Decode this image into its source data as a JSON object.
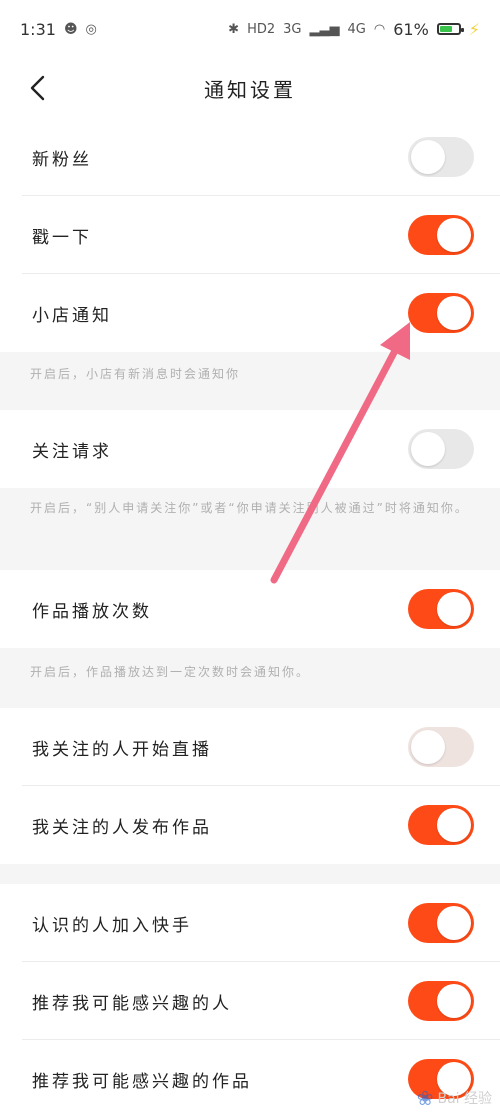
{
  "status_bar": {
    "time": "1:31",
    "network_3g": "3G",
    "network_4g": "4G",
    "hd_label": "HD2",
    "battery": "61%",
    "battery_level": 0.61
  },
  "header": {
    "title": "通知设置"
  },
  "settings": [
    {
      "label": "新粉丝",
      "on": false
    },
    {
      "label": "戳一下",
      "on": true
    },
    {
      "label": "小店通知",
      "on": true,
      "hint": "开启后，小店有新消息时会通知你"
    },
    {
      "label": "关注请求",
      "on": false,
      "hint": "开启后，“别人申请关注你”或者“你申请关注别人被通过”时将通知你。"
    },
    {
      "label": "作品播放次数",
      "on": true,
      "hint": "开启后，作品播放达到一定次数时会通知你。"
    },
    {
      "label": "我关注的人开始直播",
      "on": false
    },
    {
      "label": "我关注的人发布作品",
      "on": true
    },
    {
      "label": "认识的人加入快手",
      "on": true
    },
    {
      "label": "推荐我可能感兴趣的人",
      "on": true
    },
    {
      "label": "推荐我可能感兴趣的作品",
      "on": true
    }
  ],
  "watermark": "Bai 经验",
  "colors": {
    "toggle_on": "#fe4a16",
    "toggle_off": "#e8e8e8",
    "arrow": "#f06a86"
  }
}
